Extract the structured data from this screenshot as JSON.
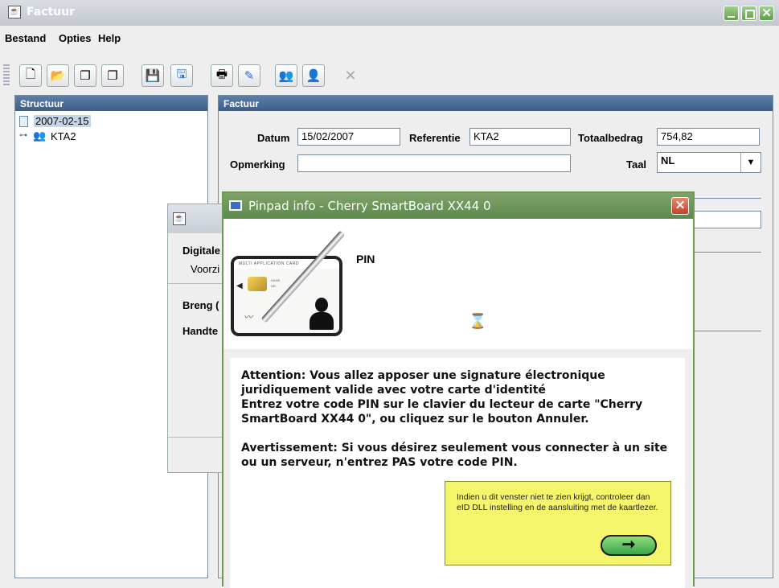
{
  "window": {
    "title": "Factuur"
  },
  "menu": [
    "Bestand",
    "Opties",
    "Help"
  ],
  "toolbar_icons": [
    "new-document-icon",
    "open-folder-icon",
    "copy-icon",
    "paste-icon",
    "save-icon",
    "save-as-icon",
    "print-icon",
    "sign-icon",
    "users-icon",
    "user-icon",
    "delete-icon"
  ],
  "structuur": {
    "header": "Structuur",
    "tree": {
      "root": "2007-02-15",
      "child": "KTA2"
    }
  },
  "factuur": {
    "header": "Factuur",
    "datum_label": "Datum",
    "datum_value": "15/02/2007",
    "referentie_label": "Referentie",
    "referentie_value": "KTA2",
    "totaal_label": "Totaalbedrag",
    "totaal_value": "754,82",
    "opmerking_label": "Opmerking",
    "opmerking_value": "",
    "taal_label": "Taal",
    "taal_value": "NL"
  },
  "back_dialog": {
    "line1": "Digitale",
    "line2": "Voorzi",
    "line3": "Breng (",
    "line4": "Handte"
  },
  "pinpad": {
    "title": "Pinpad info - Cherry SmartBoard XX44 0",
    "pin_label": "PIN",
    "card_header": "MULTI APPLICATION CARD",
    "card_name": "NAME",
    "card_nr": "NR.",
    "message1": "Attention: Vous allez apposer une signature électronique juridiquement valide avec votre carte d'identité",
    "message2": "Entrez votre code PIN sur le clavier du lecteur de carte \"Cherry SmartBoard XX44 0\", ou cliquez sur le bouton Annuler.",
    "message3": "Avertissement: Si vous désirez seulement vous connecter à un site ou un serveur, n'entrez PAS votre code PIN.",
    "tip": "Indien u dit venster niet te zien krijgt, controleer dan eID DLL instelling en de aansluiting met de kaartlezer."
  }
}
